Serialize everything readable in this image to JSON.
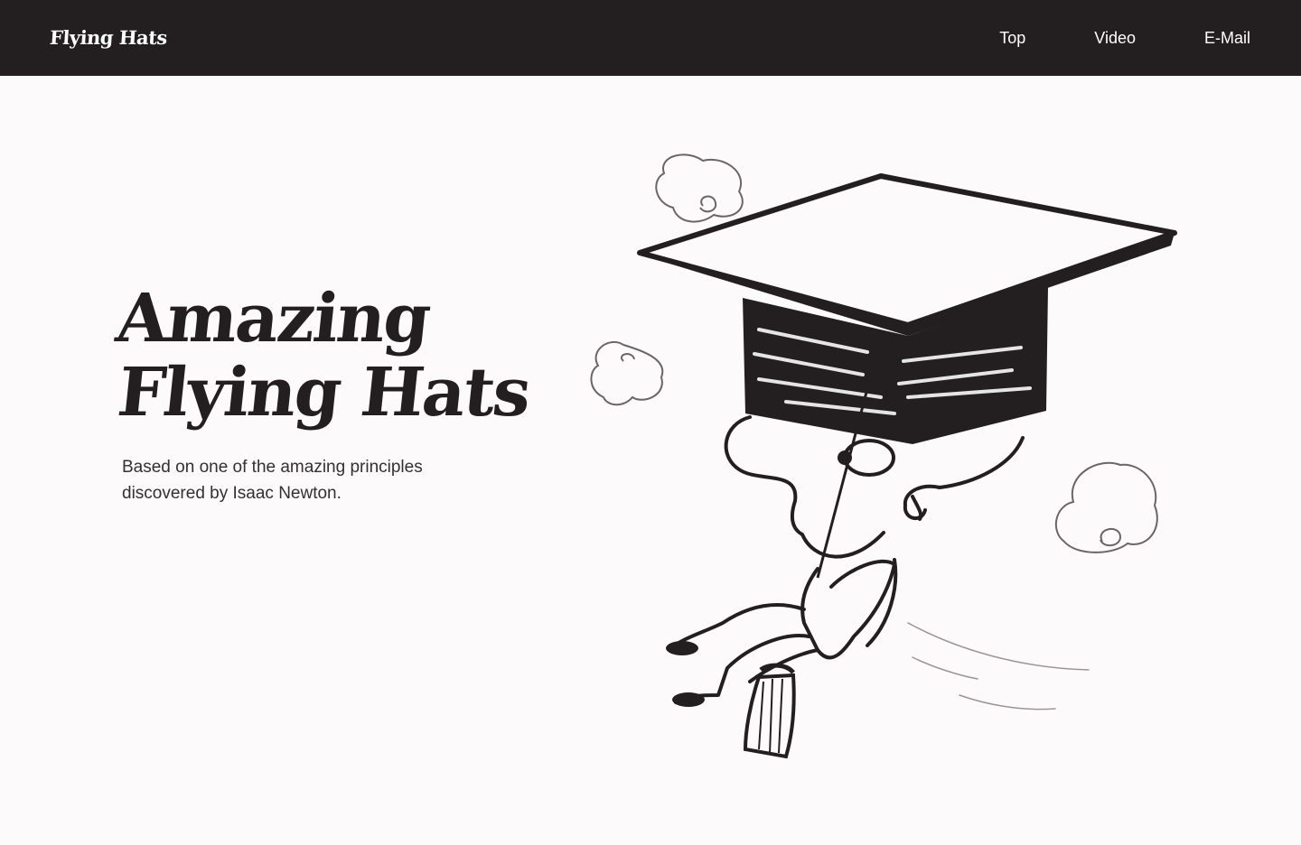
{
  "header": {
    "logo": "Flying Hats",
    "nav": [
      {
        "label": "Top"
      },
      {
        "label": "Video"
      },
      {
        "label": "E-Mail"
      }
    ]
  },
  "hero": {
    "title_line1": "Amazing",
    "title_line2": "Flying Hats",
    "subtitle_line1": "Based on one of the amazing principles",
    "subtitle_line2": "discovered by Isaac Newton."
  },
  "illustration": {
    "subject": "graduation-cap-with-person-hanging"
  },
  "colors": {
    "header_bg": "#231f20",
    "page_bg": "#fcfafa",
    "ink": "#231f20",
    "text": "#333033"
  }
}
